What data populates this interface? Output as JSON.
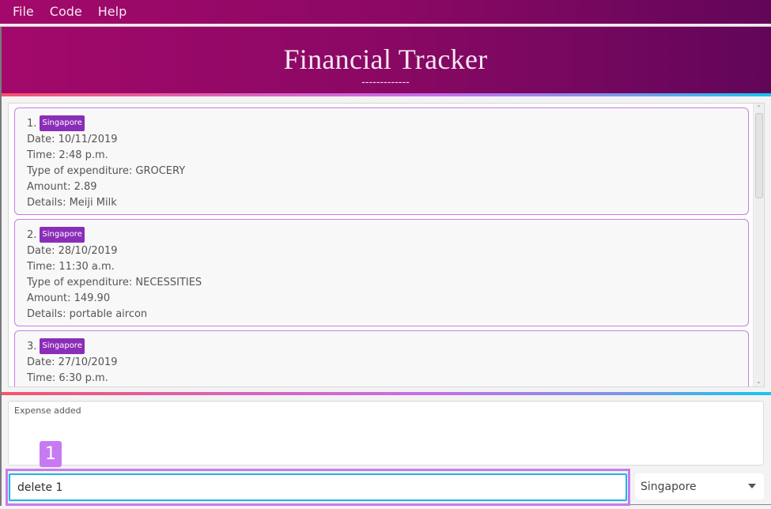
{
  "menu": {
    "items": [
      {
        "label": "File"
      },
      {
        "label": "Code"
      },
      {
        "label": "Help"
      }
    ]
  },
  "header": {
    "title": "Financial Tracker",
    "underline": "-------------"
  },
  "expenses": [
    {
      "index": "1.",
      "tag": "Singapore",
      "date": "Date: 10/11/2019",
      "time": "Time: 2:48 p.m.",
      "type": "Type of expenditure: GROCERY",
      "amount": "Amount: 2.89",
      "details": "Details: Meiji Milk"
    },
    {
      "index": "2.",
      "tag": "Singapore",
      "date": "Date: 28/10/2019",
      "time": "Time: 11:30 a.m.",
      "type": "Type of expenditure: NECESSITIES",
      "amount": "Amount: 149.90",
      "details": "Details: portable aircon"
    },
    {
      "index": "3.",
      "tag": "Singapore",
      "date": "Date: 27/10/2019",
      "time": "Time: 6:30 p.m.",
      "type": "",
      "amount": "",
      "details": ""
    }
  ],
  "result": {
    "text": "Expense added"
  },
  "annotation": {
    "badge": "1"
  },
  "command": {
    "value": "delete 1"
  },
  "country_select": {
    "selected": "Singapore"
  },
  "colors": {
    "header_start": "#a3096a",
    "header_end": "#62065a",
    "tag": "#8a2db8",
    "card_border": "#c77ee6",
    "input_border": "#1eb5e6",
    "highlight": "#c77af2"
  }
}
